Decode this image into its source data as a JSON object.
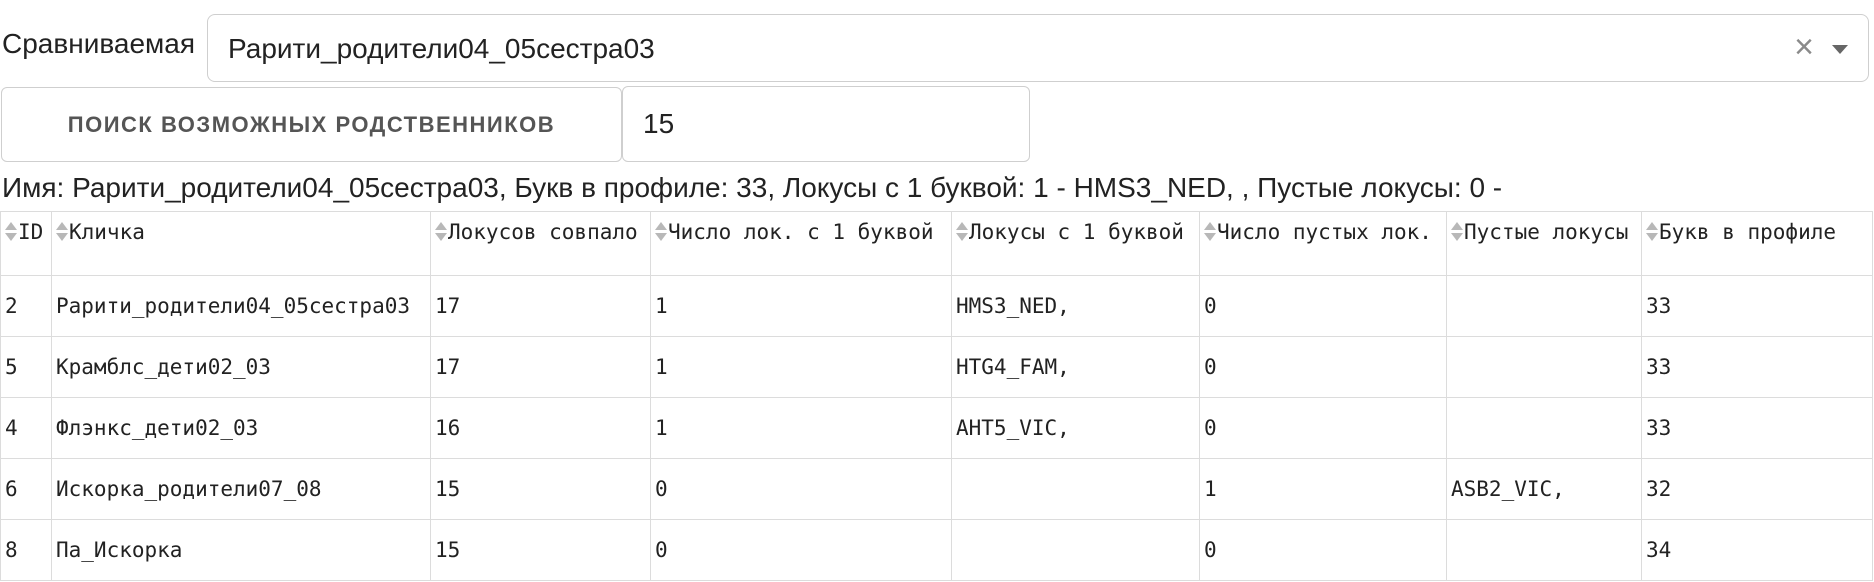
{
  "compare": {
    "label": "Сравниваемая",
    "value": "Рарити_родители04_05сестра03",
    "clear_glyph": "×"
  },
  "search": {
    "button_label": "ПОИСК ВОЗМОЖНЫХ РОДСТВЕННИКОВ",
    "count_value": "15"
  },
  "summary": "Имя: Рарити_родители04_05сестра03, Букв в профиле: 33, Локусы с 1 буквой: 1 - HMS3_NED, , Пустые локусы: 0 -",
  "table": {
    "headers": [
      "ID",
      "Кличка",
      "Локусов совпало",
      "Число лок. с 1 буквой",
      "Локусы с 1 буквой",
      "Число пустых лок.",
      "Пустые локусы",
      "Букв в профиле"
    ],
    "rows": [
      [
        "2",
        "Рарити_родители04_05сестра03",
        "17",
        "1",
        "HMS3_NED,",
        "0",
        "",
        "33"
      ],
      [
        "5",
        "Крамблс_дети02_03",
        "17",
        "1",
        "HTG4_FAM,",
        "0",
        "",
        "33"
      ],
      [
        "4",
        "Флэнкс_дети02_03",
        "16",
        "1",
        "AHT5_VIC,",
        "0",
        "",
        "33"
      ],
      [
        "6",
        "Искорка_родители07_08",
        "15",
        "0",
        "",
        "1",
        "ASB2_VIC,",
        "32"
      ],
      [
        "8",
        "Па_Искорка",
        "15",
        "0",
        "",
        "0",
        "",
        "34"
      ]
    ]
  },
  "icons": {
    "clear": "clear-icon",
    "dropdown": "chevron-down-icon",
    "sort": "sort-icon"
  },
  "colors": {
    "border": "#cfcfcf",
    "text": "#222222",
    "button_text": "#555555",
    "sort_icon": "#b8b8b8"
  }
}
